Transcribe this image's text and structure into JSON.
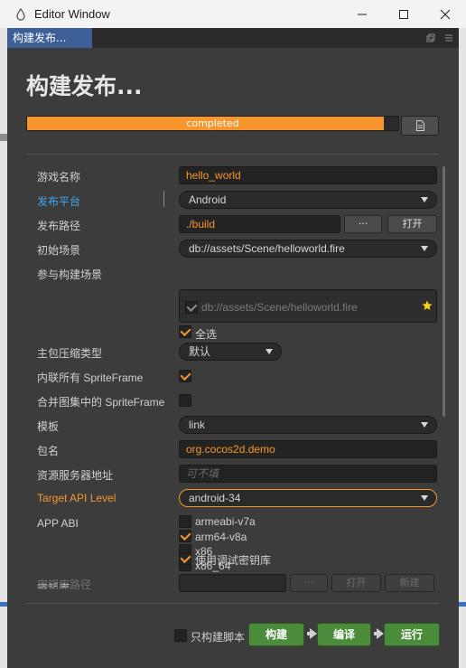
{
  "window": {
    "title": "Editor Window",
    "tab_label": "构建发布...",
    "page_title": "构建发布..."
  },
  "progress": {
    "label": "completed",
    "fraction": 0.96
  },
  "form": {
    "game_name_label": "游戏名称",
    "game_name_value": "hello_world",
    "platform_label": "发布平台",
    "platform_value": "Android",
    "build_path_label": "发布路径",
    "build_path_value": "./build",
    "browse_label": "···",
    "open_label": "打开",
    "start_scene_label": "初始场景",
    "start_scene_value": "db://assets/Scene/helloworld.fire",
    "scenes_label": "参与构建场景",
    "scene_item": "db://assets/Scene/helloworld.fire",
    "select_all_label": "全选",
    "compression_label": "主包压缩类型",
    "compression_value": "默认",
    "inline_sf_label": "内联所有 SpriteFrame",
    "merge_sf_label": "合并图集中的 SpriteFrame",
    "template_label": "模板",
    "template_value": "link",
    "package_label": "包名",
    "package_value": "org.cocos2d.demo",
    "resource_server_label": "资源服务器地址",
    "resource_server_placeholder": "可不填",
    "api_level_label": "Target API Level",
    "api_level_value": "android-34",
    "abi_label": "APP ABI",
    "abi_options": [
      "armeabi-v7a",
      "arm64-v8a",
      "x86",
      "x86_64"
    ],
    "keystore_label": "密钥库",
    "keystore_debug_label": "使用调试密钥库",
    "keystore_path_label": "密钥库路径",
    "keystore_browse": "···",
    "keystore_open": "打开",
    "keystore_new": "新建"
  },
  "footer": {
    "script_only_label": "只构建脚本",
    "build_label": "构建",
    "compile_label": "编译",
    "run_label": "运行"
  },
  "colors": {
    "accent": "#f7962c",
    "link_blue": "#3fa9f5",
    "green_button": "#4a8c3a",
    "tab_blue": "#3d5f98"
  },
  "icons": {
    "app": "cocos-creator-icon",
    "minimize": "minimize-icon",
    "maximize": "maximize-icon",
    "close": "close-icon",
    "doc": "document-icon",
    "star": "star-icon"
  }
}
